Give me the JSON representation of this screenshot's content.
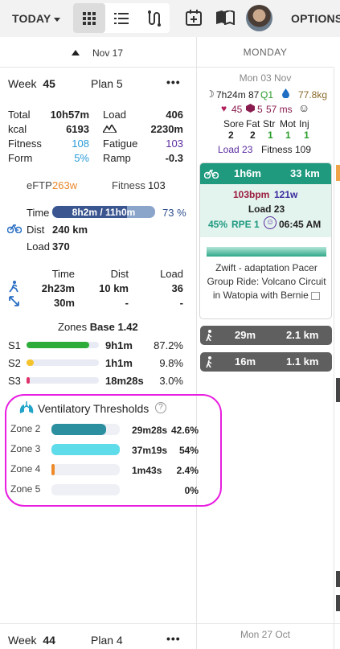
{
  "toolbar": {
    "today_label": "TODAY",
    "options_label": "OPTIONS",
    "icons": [
      "grid-icon",
      "list-icon",
      "route-icon",
      "calendar-add-icon",
      "book-map-icon",
      "avatar"
    ]
  },
  "headers": {
    "left_date": "Nov 17",
    "right_day": "MONDAY"
  },
  "week": {
    "label": "Week",
    "number": "45",
    "plan_label": "Plan 5",
    "more": "•••",
    "stats_left": [
      {
        "label": "Total",
        "value": "10h57m"
      },
      {
        "label": "kcal",
        "value": "6193"
      },
      {
        "label": "Fitness",
        "value": "108"
      },
      {
        "label": "Form",
        "value": "5%"
      }
    ],
    "stats_right": [
      {
        "label": "Load",
        "value": "406"
      },
      {
        "label": "",
        "value": "2230m"
      },
      {
        "label": "Fatigue",
        "value": "103"
      },
      {
        "label": "Ramp",
        "value": "-0.3"
      }
    ],
    "eftp_label": "eFTP",
    "eftp_value": "263w",
    "fitness_label": "Fitness",
    "fitness_value": "103",
    "time_label": "Time",
    "time_bar_text": "8h2m / 11h0m",
    "time_fraction": 0.73,
    "time_pct": "73 %",
    "dist_label": "Dist",
    "dist_value": "240 km",
    "load_label": "Load",
    "load_value": "370",
    "table_headers": [
      "Time",
      "Dist",
      "Load"
    ],
    "table_rows": [
      {
        "icon": "run-icon",
        "time": "2h23m",
        "dist": "10 km",
        "load": "36"
      },
      {
        "icon": "arrows-icon",
        "time": "30m",
        "dist": "-",
        "load": "-"
      }
    ],
    "zones_label": "Zones",
    "zones_base": "Base 1.42",
    "zones": [
      {
        "name": "S1",
        "time": "9h1m",
        "pct": "87.2%",
        "fraction": 0.872,
        "color": "#2eac3a"
      },
      {
        "name": "S2",
        "time": "1h1m",
        "pct": "9.8%",
        "fraction": 0.098,
        "color": "#f5c32c"
      },
      {
        "name": "S3",
        "time": "18m28s",
        "pct": "3.0%",
        "fraction": 0.03,
        "color": "#e0336a"
      }
    ]
  },
  "ventilatory": {
    "title": "Ventilatory Thresholds",
    "help": "?",
    "zones": [
      {
        "name": "Zone 2",
        "time": "29m28s",
        "pct": "42.6%",
        "fraction": 0.8,
        "color": "#2c8fa0"
      },
      {
        "name": "Zone 3",
        "time": "37m19s",
        "pct": "54%",
        "fraction": 1.0,
        "color": "#5fdcea"
      },
      {
        "name": "Zone 4",
        "time": "1m43s",
        "pct": "2.4%",
        "fraction": 0.05,
        "color": "#ef8a2a"
      },
      {
        "name": "Zone 5",
        "time": "",
        "pct": "0%",
        "fraction": 0,
        "color": "#cccccc"
      }
    ]
  },
  "day": {
    "date": "Mon 03 Nov",
    "sleep": "7h24m",
    "sleep_score": "87",
    "sleep_quality": "Q1",
    "weight": "77.8kg",
    "hr": "45",
    "hrv": "5",
    "hrv_ms": "57 ms",
    "wellness_headers": [
      "Sore",
      "Fat",
      "Str",
      "Mot",
      "Inj"
    ],
    "wellness_values": [
      "2",
      "2",
      "1",
      "1",
      "1"
    ],
    "load_text": "Load 23",
    "fitness_text": "Fitness 109",
    "workout": {
      "duration": "1h6m",
      "distance": "33 km",
      "bpm": "103bpm",
      "watts": "121w",
      "load": "Load 23",
      "intensity": "45%",
      "rpe": "RPE 1",
      "time": "06:45 AM",
      "title": "Zwift - adaptation Pacer Group Ride: Volcano Circuit in Watopia with Bernie"
    },
    "extra": [
      {
        "duration": "29m",
        "distance": "2.1 km"
      },
      {
        "duration": "16m",
        "distance": "1.1 km"
      }
    ]
  },
  "next_week": {
    "label": "Week",
    "number": "44",
    "plan_label": "Plan 4",
    "more": "•••",
    "date": "Mon 27 Oct"
  },
  "colors": {
    "accent_teal": "#1f9a7f",
    "fitness_blue": "#2a9bd8",
    "fatigue_purple": "#5b2d9e",
    "highlight_magenta": "#e81ee0"
  }
}
